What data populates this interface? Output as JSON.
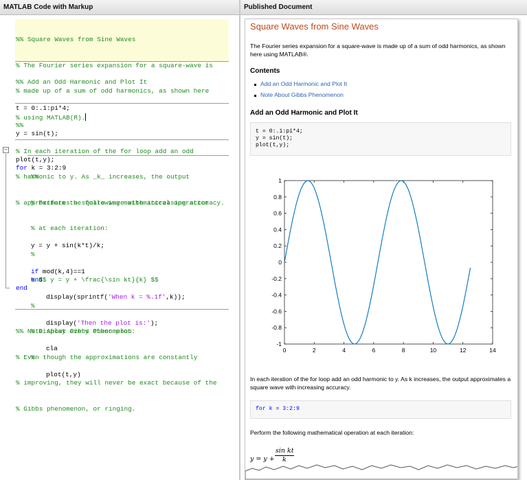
{
  "panels": {
    "left_title": "MATLAB Code with Markup",
    "right_title": "Published Document"
  },
  "code": {
    "section1": [
      "%% Square Waves from Sine Waves",
      "% The Fourier series expansion for a square-wave is",
      "% made up of a sum of odd harmonics, as shown here",
      "% using MATLAB(R)."
    ],
    "section2_title": "%% Add an Odd Harmonic and Plot It",
    "section2_code": [
      "t = 0:.1:pi*4;",
      "y = sin(t);",
      "plot(t,y);"
    ],
    "section3": [
      "%%",
      "% In each iteration of the for loop add an odd",
      "% harmonic to y. As _k_ increases, the output",
      "% approximates a square wave with increasing accuracy."
    ],
    "for_kw": "for",
    "for_rest": " k = 3:2:9",
    "loop_comments": [
      "%%",
      "% Perform the following mathematical operation",
      "% at each iteration:",
      "%",
      "% $$ y = y + \\frac{\\sin kt}{k} $$",
      "%",
      "% Display every other plot:",
      "%"
    ],
    "loop_assign": "y = y + sin(k*t)/k;",
    "if_kw": "if",
    "if_rest": " mod(k,4)==1",
    "disp1_a": "display(sprintf(",
    "disp1_str": "'When k = %.1f'",
    "disp1_b": ",k));",
    "disp2_a": "display(",
    "disp2_str": "'Then the plot is:'",
    "disp2_b": ");",
    "cla": "cla",
    "plot2": "plot(t,y)",
    "end_kw": "end",
    "section4": [
      "%% Note About Gibbs Phenomenon",
      "% Even though the approximations are constantly",
      "% improving, they will never be exact because of the",
      "% Gibbs phenomenon, or ringing."
    ]
  },
  "doc": {
    "title": "Square Waves from Sine Waves",
    "intro": "The Fourier series expansion for a square-wave is made up of a sum of odd harmonics, as shown here using MATLAB®.",
    "contents_heading": "Contents",
    "toc": [
      "Add an Odd Harmonic and Plot It",
      "Note About Gibbs Phenomenon"
    ],
    "section_heading": "Add an Odd Harmonic and Plot It",
    "code_block": "t = 0:.1:pi*4;\ny = sin(t);\nplot(t,y);",
    "para2": "In each iteration of the for loop add an odd harmonic to y. As k increases, the output approximates a square wave with increasing accuracy.",
    "code2": "for k = 3:2:9",
    "para3": "Perform the following mathematical operation at each iteration:",
    "eq_lhs": "y = y +",
    "eq_num": "sin kt",
    "eq_den": "k"
  },
  "chart_data": {
    "type": "line",
    "title": "",
    "xlabel": "",
    "ylabel": "",
    "xlim": [
      0,
      14
    ],
    "ylim": [
      -1,
      1
    ],
    "xticks": [
      0,
      2,
      4,
      6,
      8,
      10,
      12,
      14
    ],
    "yticks": [
      -1,
      -0.8,
      -0.6,
      -0.4,
      -0.2,
      0,
      0.2,
      0.4,
      0.6,
      0.8,
      1
    ],
    "ytick_labels": [
      "-1",
      "-0.8",
      "-0.6",
      "-0.4",
      "-0.2",
      "0",
      "0.2",
      "0.4",
      "0.6",
      "0.8",
      "1"
    ],
    "grid": false,
    "series": [
      {
        "color": "#0072bd",
        "x_start": 0,
        "x_step": 0.1,
        "x_end": 12.5,
        "function": "sin(t)"
      }
    ]
  }
}
